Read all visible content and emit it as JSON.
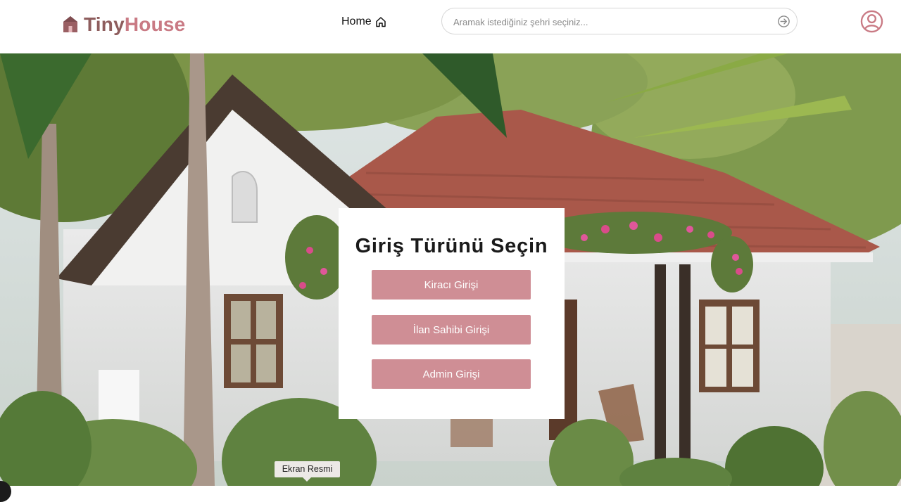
{
  "brand": {
    "name_part1": "Tiny",
    "name_part2": "House",
    "color_primary": "#8e5d5d",
    "color_accent": "#c97a84",
    "logo_icon": "house-logo-icon"
  },
  "nav": {
    "home_label": "Home",
    "home_icon": "home-icon"
  },
  "search": {
    "placeholder": "Aramak istediğiniz şehri seçiniz...",
    "value": "",
    "submit_icon": "arrow-right-circle-icon"
  },
  "user": {
    "avatar_icon": "user-circle-icon"
  },
  "hero": {
    "description_icon": "house-photo"
  },
  "login": {
    "title": "Giriş Türünü Seçin",
    "buttons": [
      {
        "label": "Kiracı Girişi"
      },
      {
        "label": "İlan Sahibi Girişi"
      },
      {
        "label": "Admin Girişi"
      }
    ],
    "button_color": "#cf8e95"
  },
  "tooltip": {
    "text": "Ekran Resmi"
  }
}
